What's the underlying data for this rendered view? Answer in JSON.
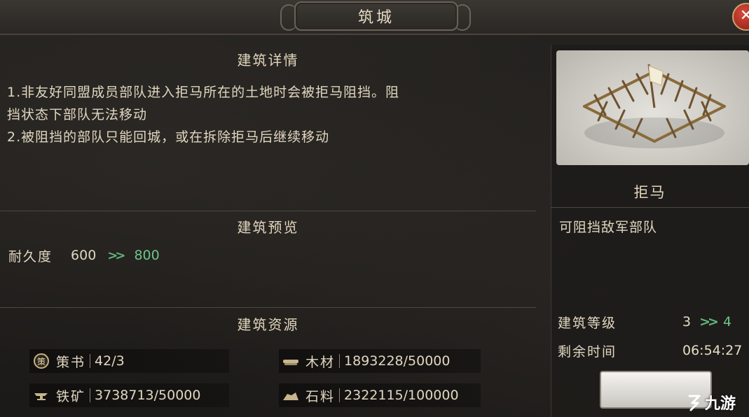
{
  "window": {
    "title": "筑城",
    "close_symbol": "✕"
  },
  "details": {
    "header": "建筑详情",
    "lines": [
      "1.非友好同盟成员部队进入拒马所在的土地时会被拒马阻挡。阻",
      "挡状态下部队无法移动",
      "2.被阻挡的部队只能回城，或在拆除拒马后继续移动"
    ]
  },
  "preview_section": {
    "header": "建筑预览",
    "durability": {
      "label": "耐久度",
      "current": "600",
      "arrow": "》",
      "next": "800"
    }
  },
  "resources": {
    "header": "建筑资源",
    "items": [
      {
        "icon": "book-seal-icon",
        "glyph": "策",
        "label": "策书",
        "value": "42/3"
      },
      {
        "icon": "wood-log-icon",
        "glyph": "▬",
        "label": "木材",
        "value": "1893228/50000"
      },
      {
        "icon": "anvil-icon",
        "glyph": "▃",
        "label": "铁矿",
        "value": "3738713/50000"
      },
      {
        "icon": "stone-icon",
        "glyph": "◣",
        "label": "石料",
        "value": "2322115/100000"
      }
    ]
  },
  "building": {
    "name": "拒马",
    "description": "可阻挡敌军部队",
    "level": {
      "label": "建筑等级",
      "current": "3",
      "arrow": "》",
      "next": "4"
    },
    "remaining": {
      "label": "剩余时间",
      "value": "06:54:27"
    }
  },
  "watermark": {
    "text": "九游"
  }
}
